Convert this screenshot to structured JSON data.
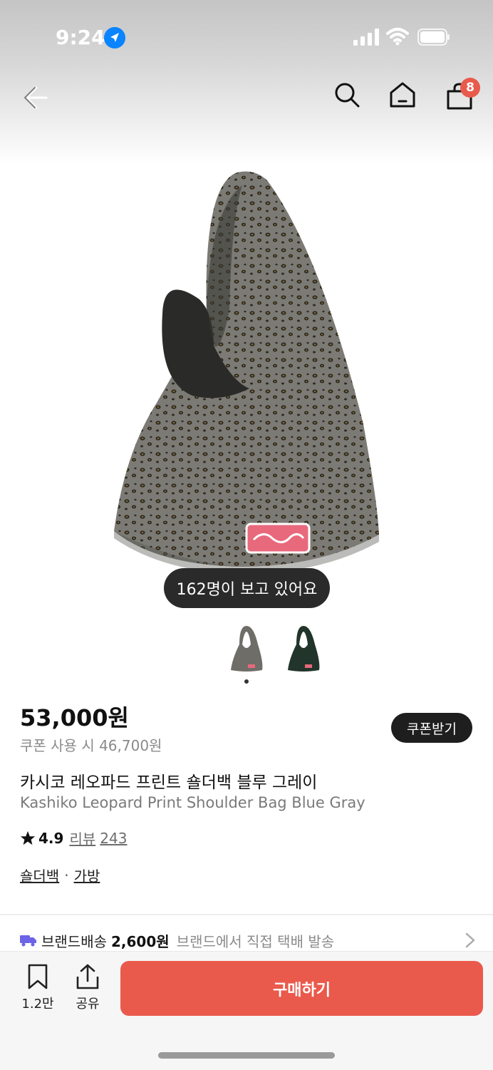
{
  "status_bar": {
    "time": "9:24"
  },
  "nav": {
    "cart_count": "8"
  },
  "product": {
    "viewers": "162명이 보고 있어요",
    "price": "53,000원",
    "coupon_price": "쿠폰 사용 시 46,700원",
    "coupon_button": "쿠폰받기",
    "title_ko": "카시코 레오파드 프린트 숄더백 블루 그레이",
    "title_en": "Kashiko Leopard Print Shoulder Bag Blue Gray",
    "rating": "4.9",
    "review_label": "리뷰",
    "review_count": "243",
    "category_1": "숄더백",
    "category_sep": "·",
    "category_2": "가방",
    "image_count": 2,
    "current_image": 1
  },
  "shipping": {
    "label": "브랜드배송",
    "price": "2,600원",
    "desc": "브랜드에서 직접 택배 발송"
  },
  "bottom": {
    "bookmark_count": "1.2만",
    "share_label": "공유",
    "buy_label": "구매하기"
  },
  "colors": {
    "accent": "#ea5a4c",
    "badge": "#e85a4b",
    "pill": "#2a2a2a",
    "location": "#0a84ff"
  }
}
